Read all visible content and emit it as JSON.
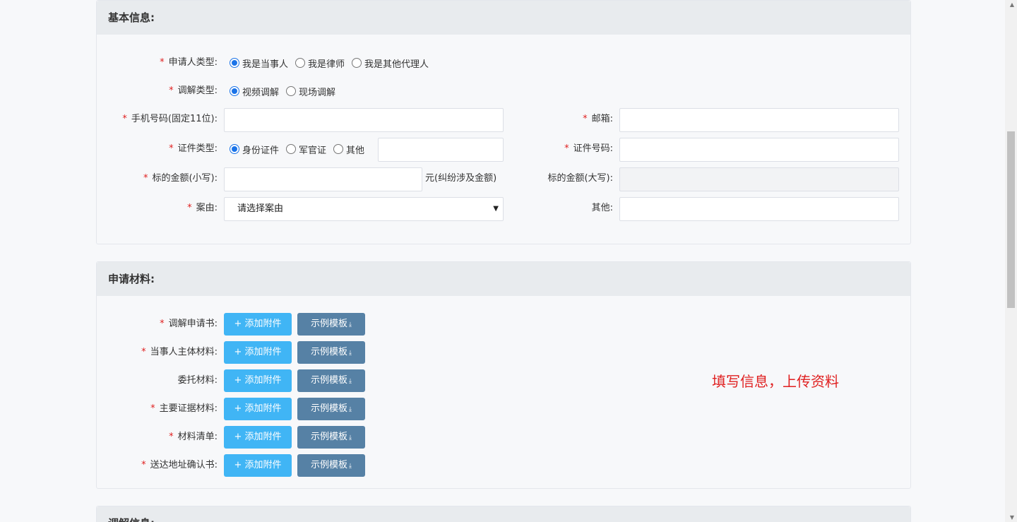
{
  "basic": {
    "title": "基本信息:",
    "applicant_type": {
      "label": "申请人类型:",
      "options": [
        "我是当事人",
        "我是律师",
        "我是其他代理人"
      ],
      "selected": 0
    },
    "mediation_type": {
      "label": "调解类型:",
      "options": [
        "视频调解",
        "现场调解"
      ],
      "selected": 0
    },
    "phone": {
      "label": "手机号码(固定11位):",
      "value": ""
    },
    "email": {
      "label": "邮箱:",
      "value": ""
    },
    "id_type": {
      "label": "证件类型:",
      "options": [
        "身份证件",
        "军官证",
        "其他"
      ],
      "selected": 0,
      "other_value": ""
    },
    "id_number": {
      "label": "证件号码:",
      "value": ""
    },
    "amount_small": {
      "label": "标的金额(小写):",
      "value": "",
      "unit": "元(纠纷涉及金额)"
    },
    "amount_big": {
      "label": "标的金额(大写):",
      "value": ""
    },
    "case_reason": {
      "label": "案由:",
      "selected": "请选择案由"
    },
    "other": {
      "label": "其他:",
      "value": ""
    }
  },
  "materials": {
    "title": "申请材料:",
    "add_label": "+ 添加附件",
    "template_label": "示例模板",
    "items": [
      {
        "label": "调解申请书:",
        "required": true
      },
      {
        "label": "当事人主体材料:",
        "required": true
      },
      {
        "label": "委托材料:",
        "required": false
      },
      {
        "label": "主要证据材料:",
        "required": true
      },
      {
        "label": "材料清单:",
        "required": true
      },
      {
        "label": "送达地址确认书:",
        "required": true
      }
    ],
    "hint": "填写信息，上传资料"
  },
  "mediation_info": {
    "title": "调解信息:"
  },
  "icons": {
    "download": "download-icon",
    "chevron": "chevron-down-icon"
  }
}
